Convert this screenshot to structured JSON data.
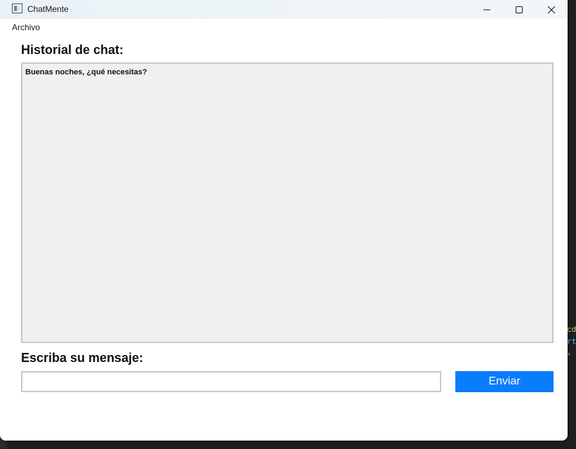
{
  "window": {
    "title": "ChatMente",
    "icon": "app-window-icon",
    "controls": [
      "minimize-icon",
      "maximize-icon",
      "close-icon"
    ]
  },
  "menubar": {
    "items": [
      {
        "label": "Archivo"
      }
    ]
  },
  "history": {
    "label": "Historial de chat:",
    "messages": [
      {
        "text": "Buenas noches, ¿qué necesitas?"
      }
    ]
  },
  "composer": {
    "label": "Escriba su mensaje:",
    "input_value": "",
    "input_placeholder": "",
    "send_label": "Enviar"
  },
  "background": {
    "left_text": "..",
    "right_lines": [
      "cd",
      "rtl",
      ","
    ]
  },
  "colors": {
    "accent": "#0a7cff",
    "history_bg": "#f0f0f0",
    "border": "#c8c8c8"
  }
}
